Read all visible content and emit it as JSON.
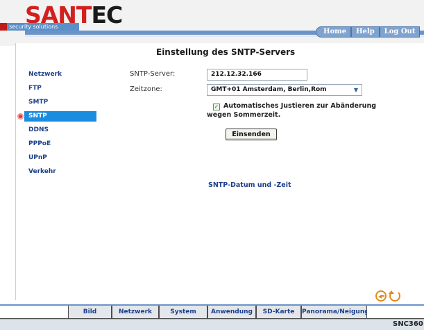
{
  "brand": {
    "logo_text_red": "SANT",
    "logo_text_dark": "EC",
    "tagline": "security solutions"
  },
  "topnav": {
    "items": [
      {
        "label": "Home"
      },
      {
        "label": "Help"
      },
      {
        "label": "Log Out"
      }
    ]
  },
  "page": {
    "title": "Einstellung des SNTP-Servers"
  },
  "sidebar": {
    "items": [
      {
        "label": "Netzwerk"
      },
      {
        "label": "FTP"
      },
      {
        "label": "SMTP"
      },
      {
        "label": "SNTP",
        "active": true
      },
      {
        "label": "DDNS"
      },
      {
        "label": "PPPoE"
      },
      {
        "label": "UPnP"
      },
      {
        "label": "Verkehr"
      }
    ]
  },
  "form": {
    "server_label": "SNTP-Server:",
    "server_value": "212.12.32.166",
    "timezone_label": "Zeitzone:",
    "timezone_value": "GMT+01 Amsterdam, Berlin,Rom",
    "dst_checked": true,
    "dst_line1": "Automatisches Justieren zur Abänderung",
    "dst_line2": "wegen Sommerzeit.",
    "submit_label": "Einsenden"
  },
  "links": {
    "date_time": "SNTP-Datum und -Zeit"
  },
  "bottomnav": {
    "items": [
      {
        "label": "Bild"
      },
      {
        "label": "Netzwerk"
      },
      {
        "label": "System"
      },
      {
        "label": "Anwendung"
      },
      {
        "label": "SD-Karte"
      },
      {
        "label": "Panorama/Neigung"
      }
    ]
  },
  "model": "SNC360",
  "colors": {
    "brand_red": "#d22020",
    "accent_blue": "#1a8de0",
    "link_blue": "#1d3f8a",
    "icon_orange": "#e08a1a"
  },
  "icons": {
    "back": "back-arrow-icon",
    "refresh": "refresh-icon"
  }
}
